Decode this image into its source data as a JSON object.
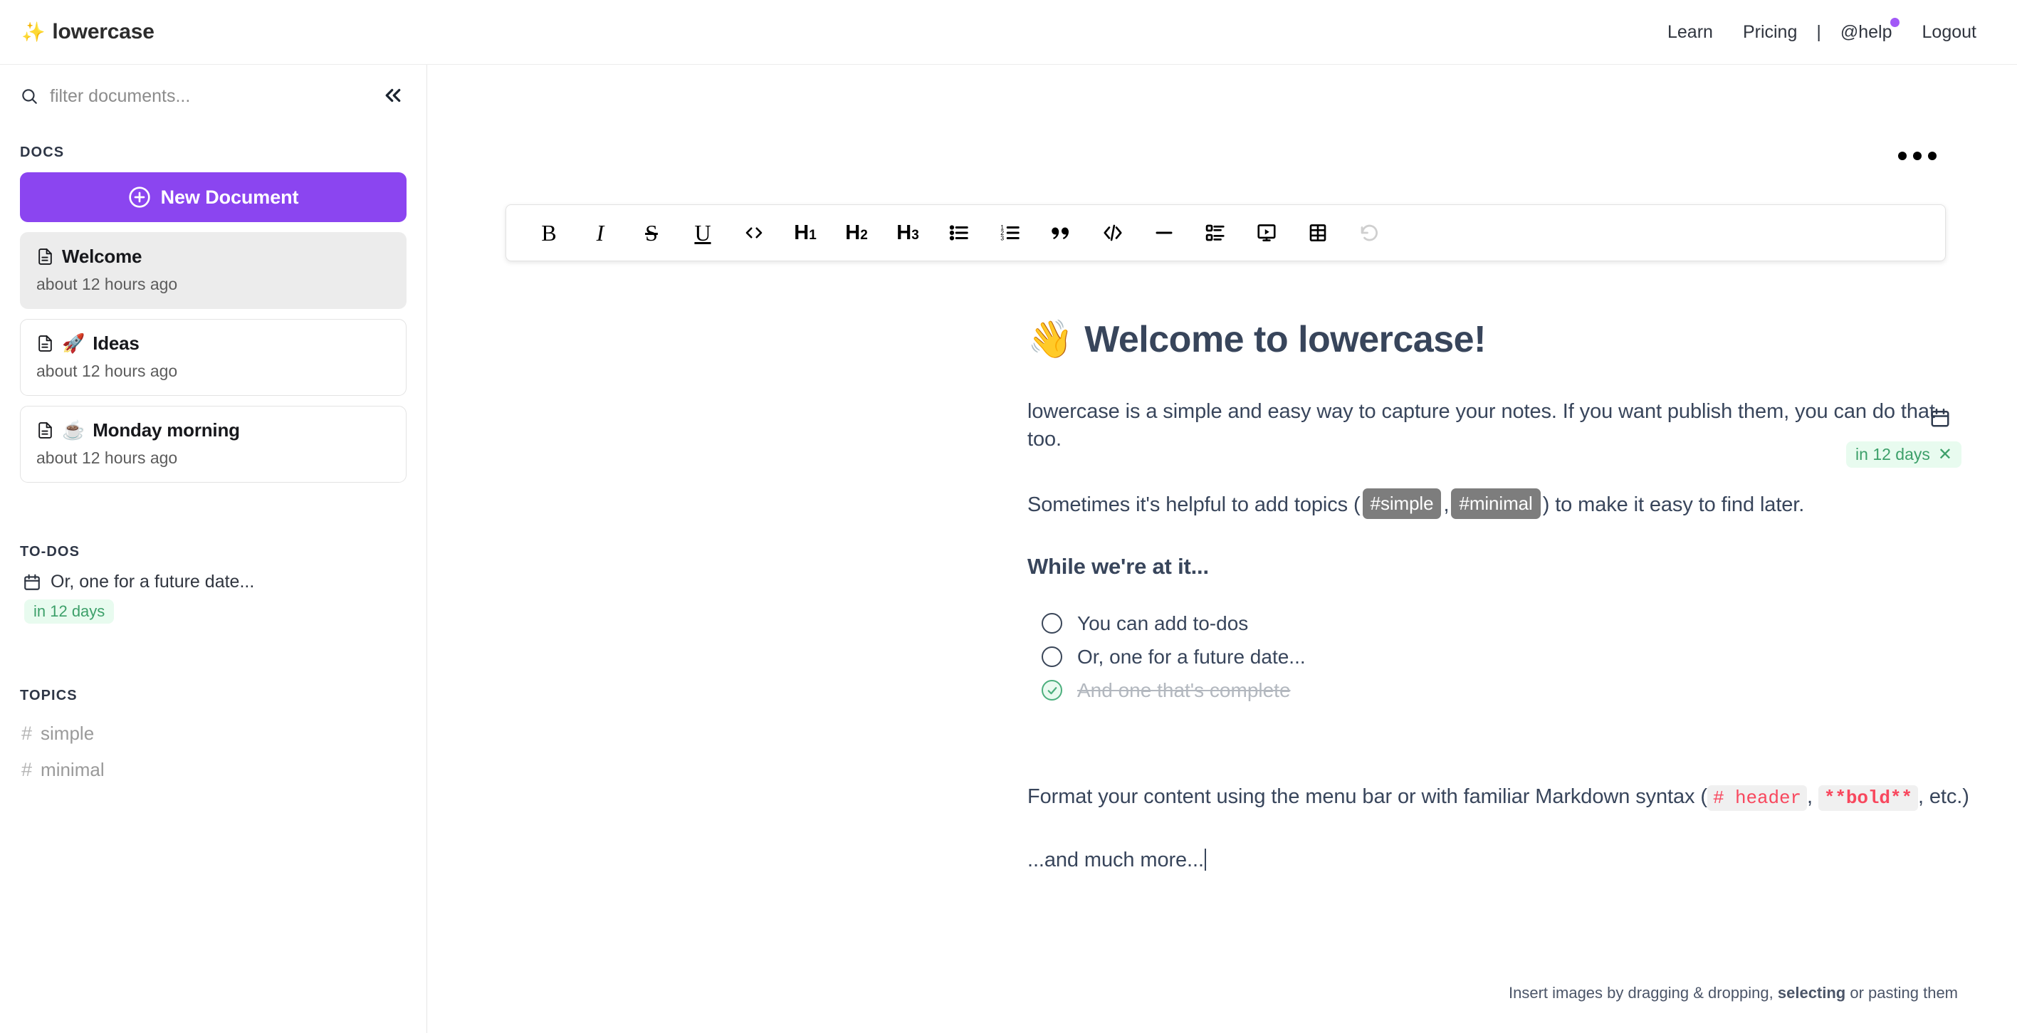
{
  "brand": {
    "spark": "✨",
    "name": "lowercase"
  },
  "topnav": {
    "learn": "Learn",
    "pricing": "Pricing",
    "separator": "|",
    "help": "@help",
    "logout": "Logout",
    "accent_color": "#a259f7"
  },
  "sidebar": {
    "search": {
      "placeholder": "filter documents...",
      "value": ""
    },
    "collapse_label": "«",
    "docs_label": "DOCS",
    "new_document": "New Document",
    "documents": [
      {
        "emoji": "",
        "title": "Welcome",
        "time": "about 12 hours ago",
        "active": true
      },
      {
        "emoji": "🚀",
        "title": "Ideas",
        "time": "about 12 hours ago",
        "active": false
      },
      {
        "emoji": "☕",
        "title": "Monday morning",
        "time": "about 12 hours ago",
        "active": false
      }
    ],
    "todos_label": "TO-DOS",
    "todos": [
      {
        "text": "Or, one for a future date...",
        "due": "in 12 days"
      }
    ],
    "topics_label": "TOPICS",
    "topics": [
      "simple",
      "minimal"
    ]
  },
  "editor": {
    "more_menu": "···",
    "toolbar": [
      {
        "name": "bold",
        "glyph": "B"
      },
      {
        "name": "italic",
        "glyph": "I"
      },
      {
        "name": "strikethrough",
        "glyph": "S"
      },
      {
        "name": "underline",
        "glyph": "U"
      },
      {
        "name": "inline-code",
        "glyph": "<>"
      },
      {
        "name": "heading-1",
        "glyph": "H1"
      },
      {
        "name": "heading-2",
        "glyph": "H2"
      },
      {
        "name": "heading-3",
        "glyph": "H3"
      },
      {
        "name": "bullet-list",
        "glyph": "•"
      },
      {
        "name": "numbered-list",
        "glyph": "1."
      },
      {
        "name": "blockquote",
        "glyph": "”"
      },
      {
        "name": "code-block",
        "glyph": "</>"
      },
      {
        "name": "horizontal-rule",
        "glyph": "—"
      },
      {
        "name": "todo-list",
        "glyph": "☑"
      },
      {
        "name": "embed",
        "glyph": "▶"
      },
      {
        "name": "table",
        "glyph": "▦"
      },
      {
        "name": "undo",
        "glyph": "↺",
        "disabled": true
      }
    ],
    "document": {
      "title_emoji": "👋",
      "title": "Welcome to lowercase!",
      "paragraph_1": "lowercase is a simple and easy way to capture your notes. If you want publish them, you can do that too.",
      "topics_line": {
        "before": "Sometimes it's helpful to add topics (",
        "tag_1": "#simple",
        "comma": ",",
        "tag_2": "#minimal",
        "after": ") to make it easy to find later."
      },
      "subheading": "While we're at it...",
      "todos": [
        {
          "text": "You can add to-dos",
          "done": false
        },
        {
          "text": "Or, one for a future date...",
          "done": false
        },
        {
          "text": "And one that's complete",
          "done": true
        }
      ],
      "due_badge": "in 12 days",
      "due_badge_close": "✕",
      "markdown_line": {
        "before": "Format your content using the menu bar or with familiar Markdown syntax (",
        "code_1": "# header",
        "comma": ",",
        "code_2": "**bold**",
        "after": ", etc.)"
      },
      "last_line": "...and much more..."
    },
    "footer_hint": {
      "before": "Insert images by dragging & dropping, ",
      "link": "selecting",
      "after": " or pasting them"
    }
  }
}
